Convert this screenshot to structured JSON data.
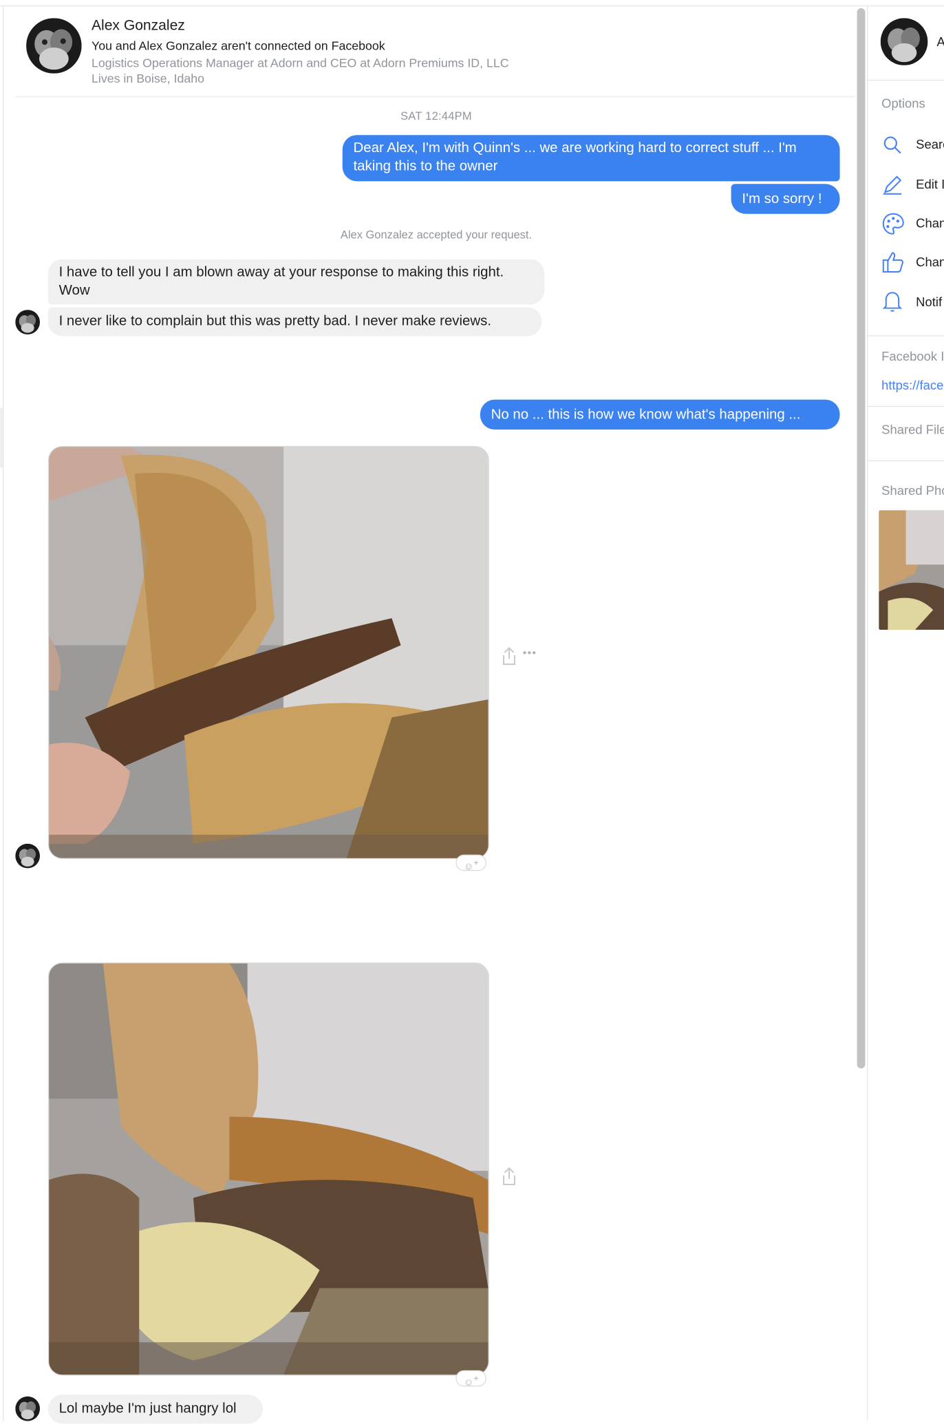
{
  "header": {
    "name": "Alex Gonzalez",
    "connection": "You and Alex Gonzalez aren't connected on Facebook",
    "job": "Logistics Operations Manager at Adorn and CEO at Adorn Premiums ID, LLC",
    "location": "Lives in Boise, Idaho"
  },
  "conversation": {
    "timestamp": "SAT 12:44PM",
    "outgoing_1": "Dear Alex, I'm with Quinn's ... we are working hard to correct stuff ... I'm taking this  to the owner",
    "outgoing_2": "I'm so sorry !",
    "system_notice": "Alex Gonzalez accepted your request.",
    "incoming_1": "I have to tell you I am blown away at your response to making this right. Wow",
    "incoming_2": "I never like to complain but this was pretty bad. I never make reviews.",
    "outgoing_3": "No no ... this is how we know what's happening ...",
    "incoming_3": "Lol maybe I'm just hangry lol",
    "more_actions": "•••"
  },
  "right_panel": {
    "name_partial": "A",
    "options_label": "Options",
    "items": [
      {
        "label": "Searc",
        "icon": "search-icon"
      },
      {
        "label": "Edit I",
        "icon": "pencil-icon"
      },
      {
        "label": "Chan",
        "icon": "palette-icon"
      },
      {
        "label": "Chan",
        "icon": "thumbs-up-icon"
      },
      {
        "label": "Notif",
        "icon": "bell-icon"
      }
    ],
    "facebook_label": "Facebook I",
    "facebook_link": "https://face",
    "shared_files_label": "Shared File",
    "shared_photos_label": "Shared Pho"
  },
  "colors": {
    "outgoing_bubble": "#3a82f0",
    "incoming_bubble": "#f1f0f0",
    "icon_blue": "#4080ff"
  }
}
